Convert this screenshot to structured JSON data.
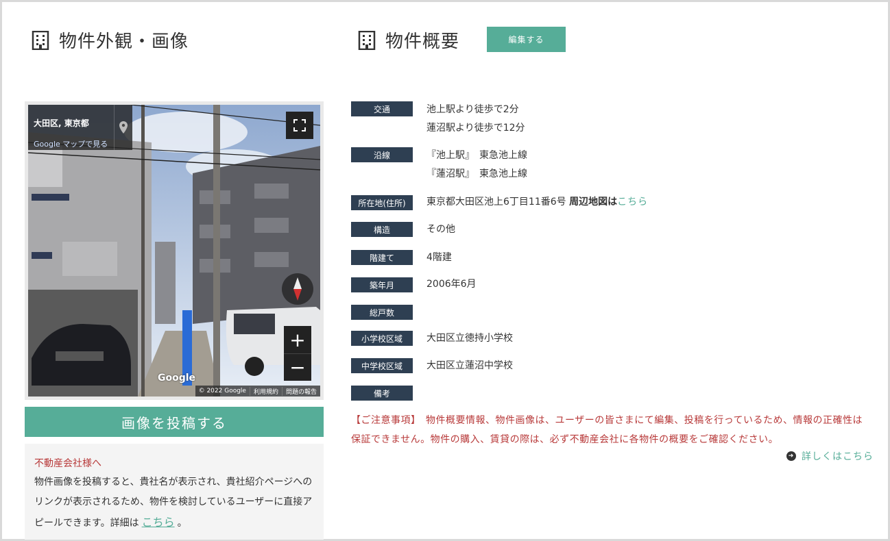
{
  "left": {
    "title": "物件外観・画像",
    "streetview": {
      "address": "大田区, 東京都",
      "maplink": "Google マップで見る",
      "logo": "Google",
      "footer": [
        "© 2022 Google",
        "利用規約",
        "問題の報告"
      ],
      "zoom_in": "+",
      "zoom_out": "−"
    },
    "post_button": "画像を投稿する",
    "agent": {
      "heading": "不動産会社様へ",
      "text": "物件画像を投稿すると、貴社名が表示され、貴社紹介ページへのリンクが表示されるため、物件を検討しているユーザーに直接アピールできます。詳細は",
      "link": "こちら",
      "tail": "。"
    }
  },
  "right": {
    "title": "物件概要",
    "edit_button": "編集する",
    "rows": [
      {
        "label": "交通",
        "lines": [
          "池上駅より徒歩で2分",
          "蓮沼駅より徒歩で12分"
        ]
      },
      {
        "label": "沿線",
        "lines": [
          "『池上駅』　東急池上線",
          "『蓮沼駅』　東急池上線"
        ]
      },
      {
        "label": "所在地(住所)",
        "address": "東京都大田区池上6丁目11番6号",
        "map_bold": "周辺地図は",
        "map_link": "こちら"
      },
      {
        "label": "構造",
        "lines": [
          "その他"
        ]
      },
      {
        "label": "階建て",
        "lines": [
          "4階建"
        ]
      },
      {
        "label": "築年月",
        "lines": [
          "2006年6月"
        ]
      },
      {
        "label": "総戸数",
        "lines": []
      },
      {
        "label": "小学校区域",
        "lines": [
          "大田区立徳持小学校"
        ]
      },
      {
        "label": "中学校区域",
        "lines": [
          "大田区立蓮沼中学校"
        ]
      },
      {
        "label": "備考",
        "lines": []
      }
    ],
    "notice": "【ご注意事項】　物件概要情報、物件画像は、ユーザーの皆さまにて編集、投稿を行っているため、情報の正確性は保証できません。物件の購入、賃貸の際は、必ず不動産会社に各物件の概要をご確認ください。",
    "more_link": "詳しくはこちら"
  },
  "colors": {
    "accent": "#56ad98",
    "label_bg": "#2e3f52",
    "notice": "#b83a3a"
  }
}
